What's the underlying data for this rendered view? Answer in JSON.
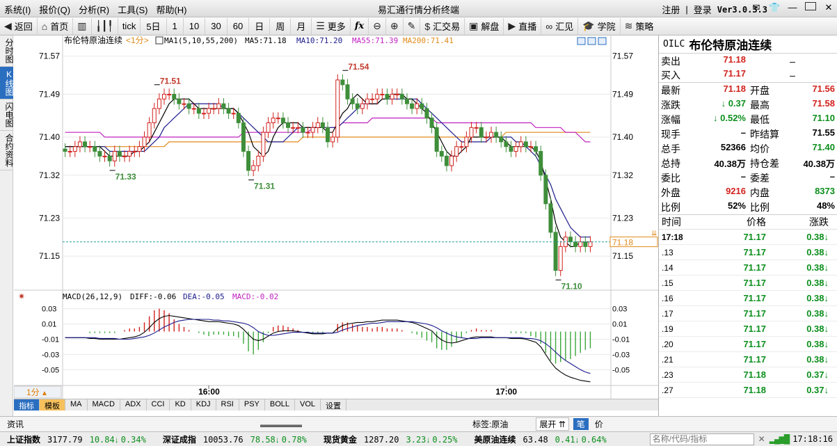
{
  "titlebar": {
    "menu": [
      "系统(I)",
      "报价(Q)",
      "分析(R)",
      "工具(S)",
      "帮助(H)"
    ],
    "app_title": "易汇通行情分析终端",
    "register": "注册",
    "divider": "|",
    "login": "登录",
    "version": "Ver3.0.3.3"
  },
  "toolbar": {
    "back": "返回",
    "home": "首页",
    "tick": "tick",
    "five_day": "5日",
    "p1": "1",
    "p10": "10",
    "p30": "30",
    "p60": "60",
    "day": "日",
    "week": "周",
    "month": "月",
    "more": "更多",
    "fx": "fx",
    "trade": "汇交易",
    "analysis": "解盘",
    "live": "直播",
    "huijian": "汇见",
    "academy": "学院",
    "strategy": "策略"
  },
  "left_tabs": [
    "分时图",
    "K线图",
    "闪电图",
    "合约资料"
  ],
  "chart_header": {
    "instrument": "布伦特原油连续",
    "period_tag": "<1分>",
    "ma_def": "MA1(5,10,55,200)",
    "ma5": "MA5:71.18",
    "ma10": "MA10:71.20",
    "ma55": "MA55:71.39",
    "ma200": "MA200:71.41"
  },
  "macd_header": {
    "def": "MACD(26,12,9)",
    "diff": "DIFF:-0.06",
    "dea": "DEA:-0.05",
    "macd": "MACD:-0.02"
  },
  "colors": {
    "up": "#d1211c",
    "down": "#3e8e3a",
    "ma5": "#000000",
    "ma10": "#1a1a8c",
    "ma55": "#c020c0",
    "ma200": "#e08a1a",
    "grid": "#e8e8e8",
    "current": "#2aa0a0"
  },
  "chart_data": {
    "type": "line",
    "price_axis_ticks": [
      "71.57",
      "71.49",
      "71.40",
      "71.32",
      "71.23",
      "71.15"
    ],
    "price_ylim": [
      71.08,
      71.59
    ],
    "macd_axis_ticks": [
      "0.03",
      "0.01",
      "-0.01",
      "-0.03",
      "-0.05"
    ],
    "macd_ylim": [
      -0.068,
      0.037
    ],
    "time_axis_ticks": [
      {
        "label": "16:00",
        "index": 29
      },
      {
        "label": "17:00",
        "index": 89
      }
    ],
    "annotations": [
      {
        "label": "71.51",
        "index": 18,
        "value": 71.51,
        "kind": "high"
      },
      {
        "label": "71.33",
        "index": 9,
        "value": 71.33,
        "kind": "low"
      },
      {
        "label": "71.31",
        "index": 37,
        "value": 71.31,
        "kind": "low"
      },
      {
        "label": "71.54",
        "index": 56,
        "value": 71.54,
        "kind": "high"
      },
      {
        "label": "71.10",
        "index": 99,
        "value": 71.1,
        "kind": "low"
      }
    ],
    "current_price": "71.18",
    "candles_close": [
      71.37,
      71.37,
      71.38,
      71.39,
      71.38,
      71.38,
      71.37,
      71.36,
      71.36,
      71.35,
      71.37,
      71.36,
      71.36,
      71.37,
      71.37,
      71.38,
      71.4,
      71.43,
      71.46,
      71.48,
      71.49,
      71.49,
      71.48,
      71.47,
      71.47,
      71.46,
      71.46,
      71.45,
      71.45,
      71.46,
      71.46,
      71.47,
      71.46,
      71.45,
      71.45,
      71.43,
      71.37,
      71.33,
      71.34,
      71.36,
      71.41,
      71.43,
      71.44,
      71.44,
      71.43,
      71.42,
      71.42,
      71.42,
      71.41,
      71.41,
      71.42,
      71.43,
      71.42,
      71.39,
      71.4,
      71.52,
      71.51,
      71.48,
      71.47,
      71.46,
      71.47,
      71.48,
      71.48,
      71.49,
      71.49,
      71.48,
      71.49,
      71.49,
      71.48,
      71.47,
      71.46,
      71.47,
      71.46,
      71.44,
      71.42,
      71.37,
      71.36,
      71.34,
      71.36,
      71.38,
      71.38,
      71.4,
      71.42,
      71.42,
      71.4,
      71.4,
      71.41,
      71.4,
      71.39,
      71.38,
      71.37,
      71.38,
      71.39,
      71.38,
      71.38,
      71.37,
      71.32,
      71.26,
      71.2,
      71.12,
      71.17,
      71.19,
      71.18,
      71.17,
      71.18,
      71.17,
      71.18
    ],
    "ma5": [
      71.38,
      71.38,
      71.38,
      71.38,
      71.38,
      71.38,
      71.38,
      71.38,
      71.37,
      71.36,
      71.36,
      71.36,
      71.36,
      71.36,
      71.37,
      71.37,
      71.38,
      71.39,
      71.41,
      71.43,
      71.45,
      71.47,
      71.48,
      71.48,
      71.48,
      71.48,
      71.47,
      71.46,
      71.46,
      71.46,
      71.46,
      71.46,
      71.46,
      71.46,
      71.46,
      71.45,
      71.43,
      71.41,
      71.38,
      71.37,
      71.36,
      71.37,
      71.4,
      71.42,
      71.43,
      71.43,
      71.43,
      71.43,
      71.42,
      71.42,
      71.42,
      71.42,
      71.42,
      71.41,
      71.41,
      71.43,
      71.45,
      71.46,
      71.48,
      71.49,
      71.48,
      71.47,
      71.47,
      71.47,
      71.48,
      71.48,
      71.49,
      71.49,
      71.49,
      71.48,
      71.48,
      71.47,
      71.46,
      71.45,
      71.43,
      71.41,
      71.39,
      71.37,
      71.36,
      71.36,
      71.37,
      71.38,
      71.4,
      71.4,
      71.4,
      71.4,
      71.4,
      71.4,
      71.4,
      71.39,
      71.38,
      71.38,
      71.38,
      71.38,
      71.38,
      71.37,
      71.35,
      71.31,
      71.27,
      71.22,
      71.19,
      71.18,
      71.17,
      71.17,
      71.18,
      71.18,
      71.18
    ],
    "ma10": [
      71.38,
      71.38,
      71.38,
      71.38,
      71.38,
      71.38,
      71.38,
      71.38,
      71.38,
      71.37,
      71.37,
      71.37,
      71.37,
      71.37,
      71.37,
      71.37,
      71.37,
      71.38,
      71.39,
      71.4,
      71.42,
      71.43,
      71.44,
      71.45,
      71.46,
      71.47,
      71.47,
      71.47,
      71.47,
      71.47,
      71.47,
      71.47,
      71.46,
      71.46,
      71.46,
      71.45,
      71.44,
      71.43,
      71.42,
      71.41,
      71.4,
      71.39,
      71.39,
      71.39,
      71.39,
      71.4,
      71.41,
      71.42,
      71.42,
      71.42,
      71.42,
      71.42,
      71.42,
      71.42,
      71.42,
      71.42,
      71.43,
      71.44,
      71.45,
      71.46,
      71.47,
      71.47,
      71.47,
      71.47,
      71.48,
      71.48,
      71.48,
      71.48,
      71.48,
      71.48,
      71.48,
      71.48,
      71.47,
      71.46,
      71.45,
      71.44,
      71.43,
      71.42,
      71.41,
      71.4,
      71.39,
      71.39,
      71.39,
      71.39,
      71.39,
      71.39,
      71.4,
      71.4,
      71.4,
      71.4,
      71.4,
      71.39,
      71.39,
      71.38,
      71.37,
      71.36,
      71.34,
      71.32,
      71.3,
      71.27,
      71.25,
      71.23,
      71.21,
      71.2,
      71.19,
      71.19,
      71.19
    ],
    "ma55": [
      71.41,
      71.41,
      71.41,
      71.41,
      71.41,
      71.41,
      71.41,
      71.41,
      71.4,
      71.4,
      71.4,
      71.4,
      71.4,
      71.4,
      71.4,
      71.4,
      71.4,
      71.4,
      71.4,
      71.4,
      71.4,
      71.4,
      71.4,
      71.4,
      71.4,
      71.4,
      71.4,
      71.4,
      71.4,
      71.4,
      71.4,
      71.4,
      71.4,
      71.4,
      71.4,
      71.4,
      71.41,
      71.41,
      71.41,
      71.41,
      71.41,
      71.41,
      71.41,
      71.41,
      71.41,
      71.41,
      71.41,
      71.41,
      71.41,
      71.41,
      71.42,
      71.42,
      71.42,
      71.42,
      71.42,
      71.42,
      71.43,
      71.43,
      71.43,
      71.43,
      71.43,
      71.43,
      71.44,
      71.44,
      71.44,
      71.44,
      71.44,
      71.44,
      71.44,
      71.44,
      71.44,
      71.44,
      71.44,
      71.44,
      71.44,
      71.43,
      71.43,
      71.43,
      71.43,
      71.43,
      71.43,
      71.43,
      71.43,
      71.43,
      71.43,
      71.43,
      71.43,
      71.43,
      71.43,
      71.43,
      71.43,
      71.43,
      71.43,
      71.43,
      71.43,
      71.42,
      71.42,
      71.42,
      71.42,
      71.42,
      71.42,
      71.41,
      71.41,
      71.41,
      71.4,
      71.39,
      71.39
    ],
    "ma200": [
      71.38,
      71.38,
      71.38,
      71.38,
      71.38,
      71.38,
      71.38,
      71.38,
      71.38,
      71.38,
      71.38,
      71.38,
      71.38,
      71.38,
      71.38,
      71.38,
      71.38,
      71.38,
      71.38,
      71.38,
      71.38,
      71.39,
      71.39,
      71.39,
      71.39,
      71.39,
      71.39,
      71.39,
      71.39,
      71.39,
      71.39,
      71.39,
      71.39,
      71.39,
      71.39,
      71.39,
      71.39,
      71.39,
      71.39,
      71.39,
      71.39,
      71.39,
      71.39,
      71.39,
      71.39,
      71.39,
      71.39,
      71.39,
      71.4,
      71.4,
      71.4,
      71.4,
      71.4,
      71.4,
      71.4,
      71.4,
      71.4,
      71.4,
      71.4,
      71.4,
      71.4,
      71.4,
      71.4,
      71.4,
      71.4,
      71.4,
      71.4,
      71.4,
      71.4,
      71.4,
      71.4,
      71.4,
      71.4,
      71.4,
      71.4,
      71.4,
      71.4,
      71.4,
      71.4,
      71.4,
      71.4,
      71.4,
      71.4,
      71.4,
      71.4,
      71.4,
      71.4,
      71.4,
      71.4,
      71.41,
      71.41,
      71.41,
      71.41,
      71.41,
      71.41,
      71.41,
      71.41,
      71.41,
      71.41,
      71.41,
      71.41,
      71.41,
      71.41,
      71.41,
      71.41,
      71.41,
      71.41
    ],
    "diff": [
      -0.008,
      -0.008,
      -0.008,
      -0.008,
      -0.008,
      -0.009,
      -0.009,
      -0.01,
      -0.01,
      -0.01,
      -0.01,
      -0.01,
      -0.009,
      -0.008,
      -0.007,
      -0.005,
      -0.001,
      0.005,
      0.012,
      0.017,
      0.02,
      0.021,
      0.02,
      0.019,
      0.018,
      0.017,
      0.016,
      0.015,
      0.014,
      0.013,
      0.013,
      0.013,
      0.012,
      0.011,
      0.01,
      0.008,
      0.003,
      -0.004,
      -0.01,
      -0.012,
      -0.01,
      -0.006,
      -0.002,
      0.0,
      0.001,
      0.001,
      0.001,
      0.0,
      -0.001,
      -0.002,
      -0.003,
      -0.003,
      -0.003,
      -0.002,
      -0.002,
      0.004,
      0.008,
      0.01,
      0.011,
      0.012,
      0.012,
      0.013,
      0.013,
      0.014,
      0.015,
      0.015,
      0.015,
      0.015,
      0.014,
      0.013,
      0.012,
      0.01,
      0.007,
      0.004,
      0.001,
      -0.006,
      -0.011,
      -0.014,
      -0.015,
      -0.014,
      -0.012,
      -0.01,
      -0.008,
      -0.007,
      -0.007,
      -0.007,
      -0.007,
      -0.008,
      -0.008,
      -0.008,
      -0.009,
      -0.009,
      -0.009,
      -0.01,
      -0.012,
      -0.014,
      -0.02,
      -0.03,
      -0.04,
      -0.048,
      -0.053,
      -0.057,
      -0.06,
      -0.062,
      -0.064,
      -0.065,
      -0.066
    ],
    "dea": [
      -0.008,
      -0.008,
      -0.008,
      -0.008,
      -0.008,
      -0.008,
      -0.008,
      -0.009,
      -0.009,
      -0.009,
      -0.009,
      -0.01,
      -0.01,
      -0.01,
      -0.009,
      -0.008,
      -0.007,
      -0.005,
      -0.002,
      0.002,
      0.006,
      0.009,
      0.012,
      0.014,
      0.015,
      0.016,
      0.016,
      0.016,
      0.016,
      0.016,
      0.015,
      0.015,
      0.014,
      0.014,
      0.013,
      0.012,
      0.011,
      0.009,
      0.005,
      0.0,
      -0.003,
      -0.005,
      -0.005,
      -0.004,
      -0.003,
      -0.002,
      -0.001,
      -0.001,
      -0.001,
      -0.001,
      -0.002,
      -0.002,
      -0.002,
      -0.002,
      -0.002,
      -0.001,
      0.002,
      0.004,
      0.006,
      0.008,
      0.009,
      0.01,
      0.011,
      0.011,
      0.012,
      0.013,
      0.013,
      0.013,
      0.013,
      0.013,
      0.013,
      0.012,
      0.011,
      0.01,
      0.008,
      0.005,
      0.001,
      -0.002,
      -0.005,
      -0.007,
      -0.008,
      -0.009,
      -0.009,
      -0.009,
      -0.008,
      -0.008,
      -0.008,
      -0.008,
      -0.008,
      -0.008,
      -0.008,
      -0.008,
      -0.008,
      -0.009,
      -0.009,
      -0.01,
      -0.012,
      -0.016,
      -0.021,
      -0.027,
      -0.033,
      -0.038,
      -0.042,
      -0.046,
      -0.05,
      -0.053,
      -0.055
    ]
  },
  "right_panel": {
    "code": "OILC",
    "name": "布伦特原油连续",
    "sell_label": "卖出",
    "sell_value": "71.18",
    "sell_vol": "–",
    "buy_label": "买入",
    "buy_value": "71.17",
    "buy_vol": "–",
    "quotes": [
      {
        "l1": "最新",
        "v1": "71.18",
        "c1": "red",
        "l2": "开盘",
        "v2": "71.56",
        "c2": "red"
      },
      {
        "l1": "涨跌",
        "v1": "0.37",
        "c1": "green",
        "a1": "down",
        "l2": "最高",
        "v2": "71.58",
        "c2": "red"
      },
      {
        "l1": "涨幅",
        "v1": "0.52%",
        "c1": "green",
        "a1": "down",
        "l2": "最低",
        "v2": "71.10",
        "c2": "green"
      },
      {
        "l1": "现手",
        "v1": "–",
        "c1": "blk",
        "l2": "昨结算",
        "v2": "71.55",
        "c2": "blk"
      },
      {
        "l1": "总手",
        "v1": "52366",
        "c1": "blk",
        "l2": "均价",
        "v2": "71.40",
        "c2": "green"
      },
      {
        "l1": "总持",
        "v1": "40.38万",
        "c1": "blk",
        "l2": "持仓差",
        "v2": "40.38万",
        "c2": "blk"
      },
      {
        "l1": "委比",
        "v1": "–",
        "c1": "blk",
        "l2": "委差",
        "v2": "–",
        "c2": "blk"
      },
      {
        "l1": "外盘",
        "v1": "9216",
        "c1": "red",
        "l2": "内盘",
        "v2": "8373",
        "c2": "green"
      },
      {
        "l1": "比例",
        "v1": "52%",
        "c1": "blk",
        "l2": "比例",
        "v2": "48%",
        "c2": "blk"
      }
    ],
    "trades_head": {
      "time": "时间",
      "price": "价格",
      "change": "涨跌"
    },
    "trades": [
      {
        "time": "17:18",
        "price": "71.17",
        "change": "0.38"
      },
      {
        "time": ".13",
        "price": "71.17",
        "change": "0.38"
      },
      {
        "time": ".14",
        "price": "71.17",
        "change": "0.38"
      },
      {
        "time": ".15",
        "price": "71.17",
        "change": "0.38"
      },
      {
        "time": ".16",
        "price": "71.17",
        "change": "0.38"
      },
      {
        "time": ".17",
        "price": "71.17",
        "change": "0.38"
      },
      {
        "time": ".19",
        "price": "71.17",
        "change": "0.38"
      },
      {
        "time": ".20",
        "price": "71.17",
        "change": "0.38"
      },
      {
        "time": ".21",
        "price": "71.17",
        "change": "0.38"
      },
      {
        "time": ".23",
        "price": "71.18",
        "change": "0.37"
      },
      {
        "time": ".27",
        "price": "71.18",
        "change": "0.37"
      }
    ],
    "tabs": [
      "笔",
      "价"
    ]
  },
  "chart_bottom": {
    "period": "1分",
    "tabs": [
      "指标",
      "模板",
      "MA",
      "MACD",
      "ADX",
      "CCI",
      "KD",
      "KDJ",
      "RSI",
      "PSY",
      "BOLL",
      "VOL",
      "设置"
    ]
  },
  "infobar": {
    "news": "资讯",
    "tag": "标签:原油",
    "expand": "展开"
  },
  "statusbar": {
    "markets": [
      {
        "name": "上证指数",
        "value": "3177.79",
        "chg": "10.84",
        "pct": "0.34%"
      },
      {
        "name": "深证成指",
        "value": "10053.76",
        "chg": "78.58",
        "pct": "0.78%"
      },
      {
        "name": "现货黄金",
        "value": "1287.20",
        "chg": "3.23",
        "pct": "0.25%"
      },
      {
        "name": "美原油连续",
        "value": "63.48",
        "chg": "0.41",
        "pct": "0.64%"
      }
    ],
    "search_placeholder": "名称/代码/指标",
    "time": "17:18:16"
  }
}
